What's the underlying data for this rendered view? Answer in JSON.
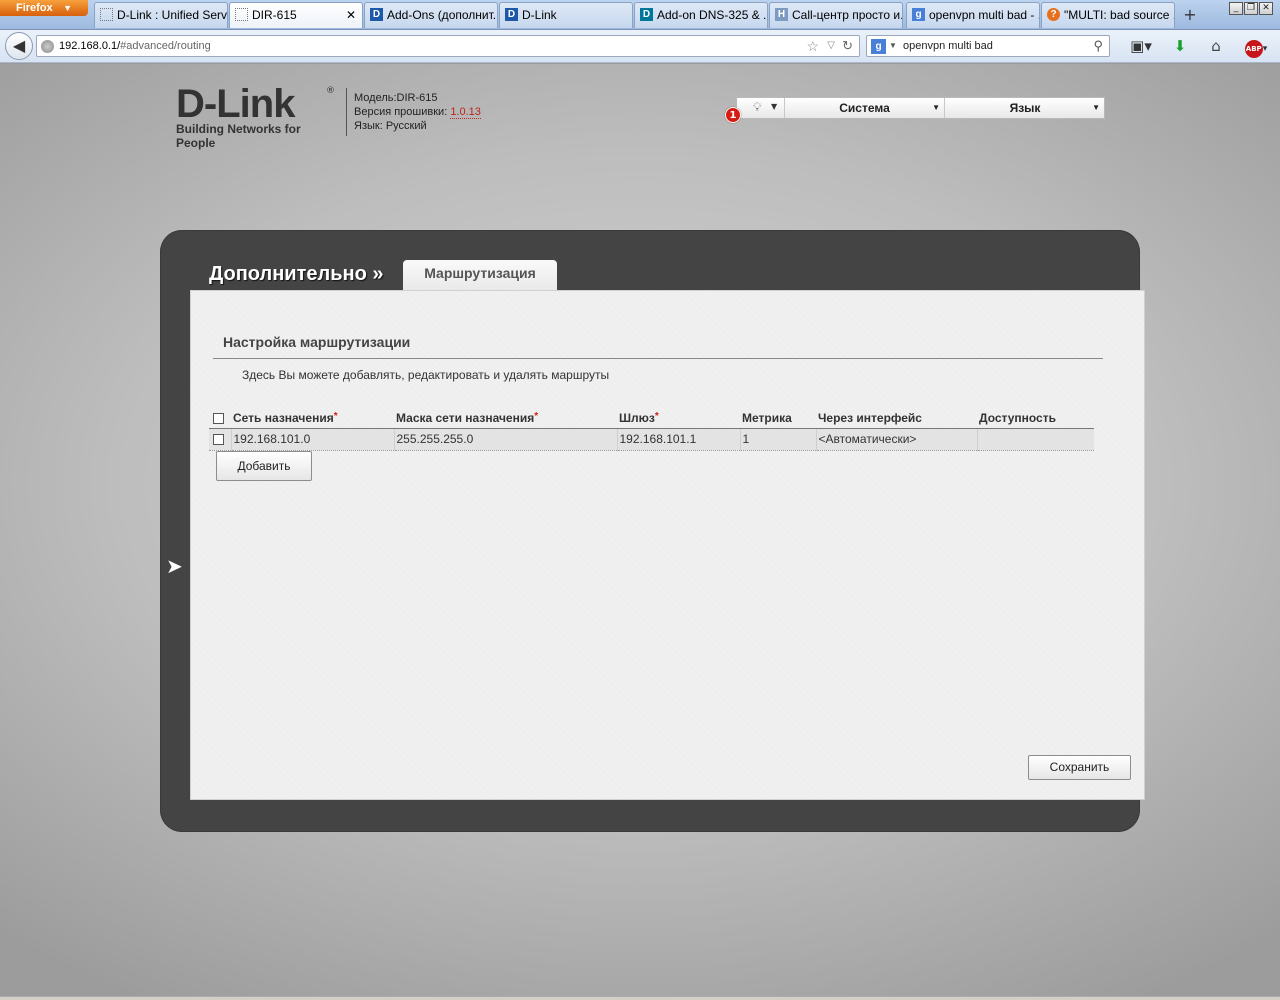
{
  "browser": {
    "app_button": "Firefox",
    "tabs": [
      {
        "label": "D-Link : Unified Servi...",
        "favicon": "blank-page-icon"
      },
      {
        "label": "DIR-615",
        "favicon": "blank-page-icon",
        "active": true
      },
      {
        "label": "Add-Ons (дополнит...",
        "favicon": "dlink-favicon"
      },
      {
        "label": "D-Link",
        "favicon": "dlink-favicon"
      },
      {
        "label": "Add-on DNS-325 & ...",
        "favicon": "dlink-favicon"
      },
      {
        "label": "Call-центр просто и...",
        "favicon": "hh-favicon"
      },
      {
        "label": "openvpn multi bad - ...",
        "favicon": "google-favicon"
      },
      {
        "label": "\"MULTI: bad source ...",
        "favicon": "forum-favicon"
      }
    ],
    "url_host": "192.168.0.1/",
    "url_path": "#advanced/routing",
    "search_value": "openvpn multi bad"
  },
  "header": {
    "logo_text": "D-Link",
    "logo_tagline": "Building Networks for People",
    "model_label": "Модель:",
    "model_value": "DIR-615",
    "firmware_label": "Версия прошивки:",
    "firmware_value": "1.0.13",
    "language_label": "Язык:",
    "language_value": "Русский",
    "notification_count": "1",
    "menu_system": "Система",
    "menu_language": "Язык"
  },
  "page": {
    "breadcrumb": "Дополнительно »",
    "tab_label": "Маршрутизация",
    "section_title": "Настройка маршрутизации",
    "description": "Здесь Вы можете добавлять, редактировать и удалять маршруты",
    "columns": [
      {
        "label": "Сеть назначения",
        "required": true
      },
      {
        "label": "Маска сети назначения",
        "required": true
      },
      {
        "label": "Шлюз",
        "required": true
      },
      {
        "label": "Метрика",
        "required": false
      },
      {
        "label": "Через интерфейс",
        "required": false
      },
      {
        "label": "Доступность",
        "required": false
      }
    ],
    "rows": [
      {
        "network": "192.168.101.0",
        "mask": "255.255.255.0",
        "gateway": "192.168.101.1",
        "metric": "1",
        "interface": "<Автоматически>",
        "availability": ""
      }
    ],
    "add_button": "Добавить",
    "save_button": "Сохранить"
  },
  "colors": {
    "accent_red": "#d41b14",
    "frame_dark": "#444444"
  }
}
